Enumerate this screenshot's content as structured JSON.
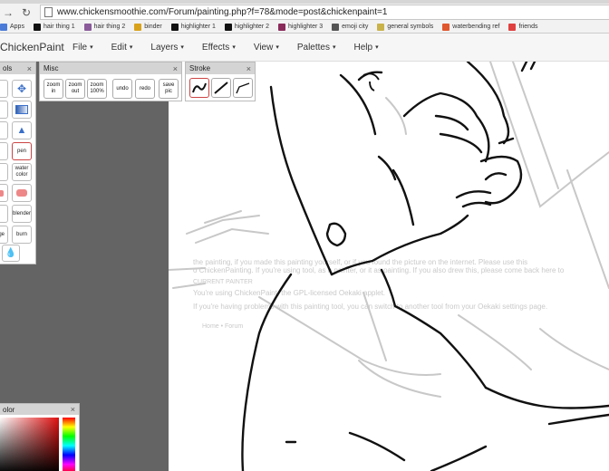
{
  "browser": {
    "url": "www.chickensmoothie.com/Forum/painting.php?f=78&mode=post&chickenpaint=1",
    "bookmarks": [
      {
        "label": "Apps",
        "color": "#4a7bd8"
      },
      {
        "label": "hair thing 1",
        "color": "#111111"
      },
      {
        "label": "hair thing 2",
        "color": "#8a5a9a"
      },
      {
        "label": "binder",
        "color": "#d9a21b"
      },
      {
        "label": "highlighter 1",
        "color": "#111111"
      },
      {
        "label": "highlighter 2",
        "color": "#111111"
      },
      {
        "label": "highlighter 3",
        "color": "#8a2a5a"
      },
      {
        "label": "emoji city",
        "color": "#555555"
      },
      {
        "label": "general symbols",
        "color": "#c9b24a"
      },
      {
        "label": "waterbending ref",
        "color": "#e0562d"
      },
      {
        "label": "friends",
        "color": "#e04040"
      }
    ]
  },
  "app": {
    "title": "ChickenPaint",
    "menus": [
      "File",
      "Edit",
      "Layers",
      "Effects",
      "View",
      "Palettes",
      "Help"
    ]
  },
  "palettes": {
    "tools": {
      "title": "ols",
      "buttons": [
        "pen",
        "water color",
        "blender",
        "dge",
        "burn"
      ]
    },
    "misc": {
      "title": "Misc",
      "buttons": [
        "zoom in",
        "zoom out",
        "zoom 100%",
        "undo",
        "redo",
        "save pic"
      ]
    },
    "stroke": {
      "title": "Stroke"
    },
    "color": {
      "title": "olor"
    }
  },
  "canvas_ghost": {
    "line1": "the painting, if you made this painting yourself, or if you found the picture on the internet. Please use this",
    "line2": "o ChickenPainting. If you're using tool, as a painter, or it as painting. If you also drew this, please come back here to",
    "label": "CURRENT PAINTER",
    "line3": "You're using ChickenPaint, the GPL-licensed Oekaki applet.",
    "line4": "If you're having problems with this painting tool, you can switch to another tool from your Oekaki settings page.",
    "crumb": "Home • Forum"
  },
  "colors": {
    "panel_header": "#d4d4d4",
    "workspace": "#646464",
    "active_border": "#cc4444"
  }
}
